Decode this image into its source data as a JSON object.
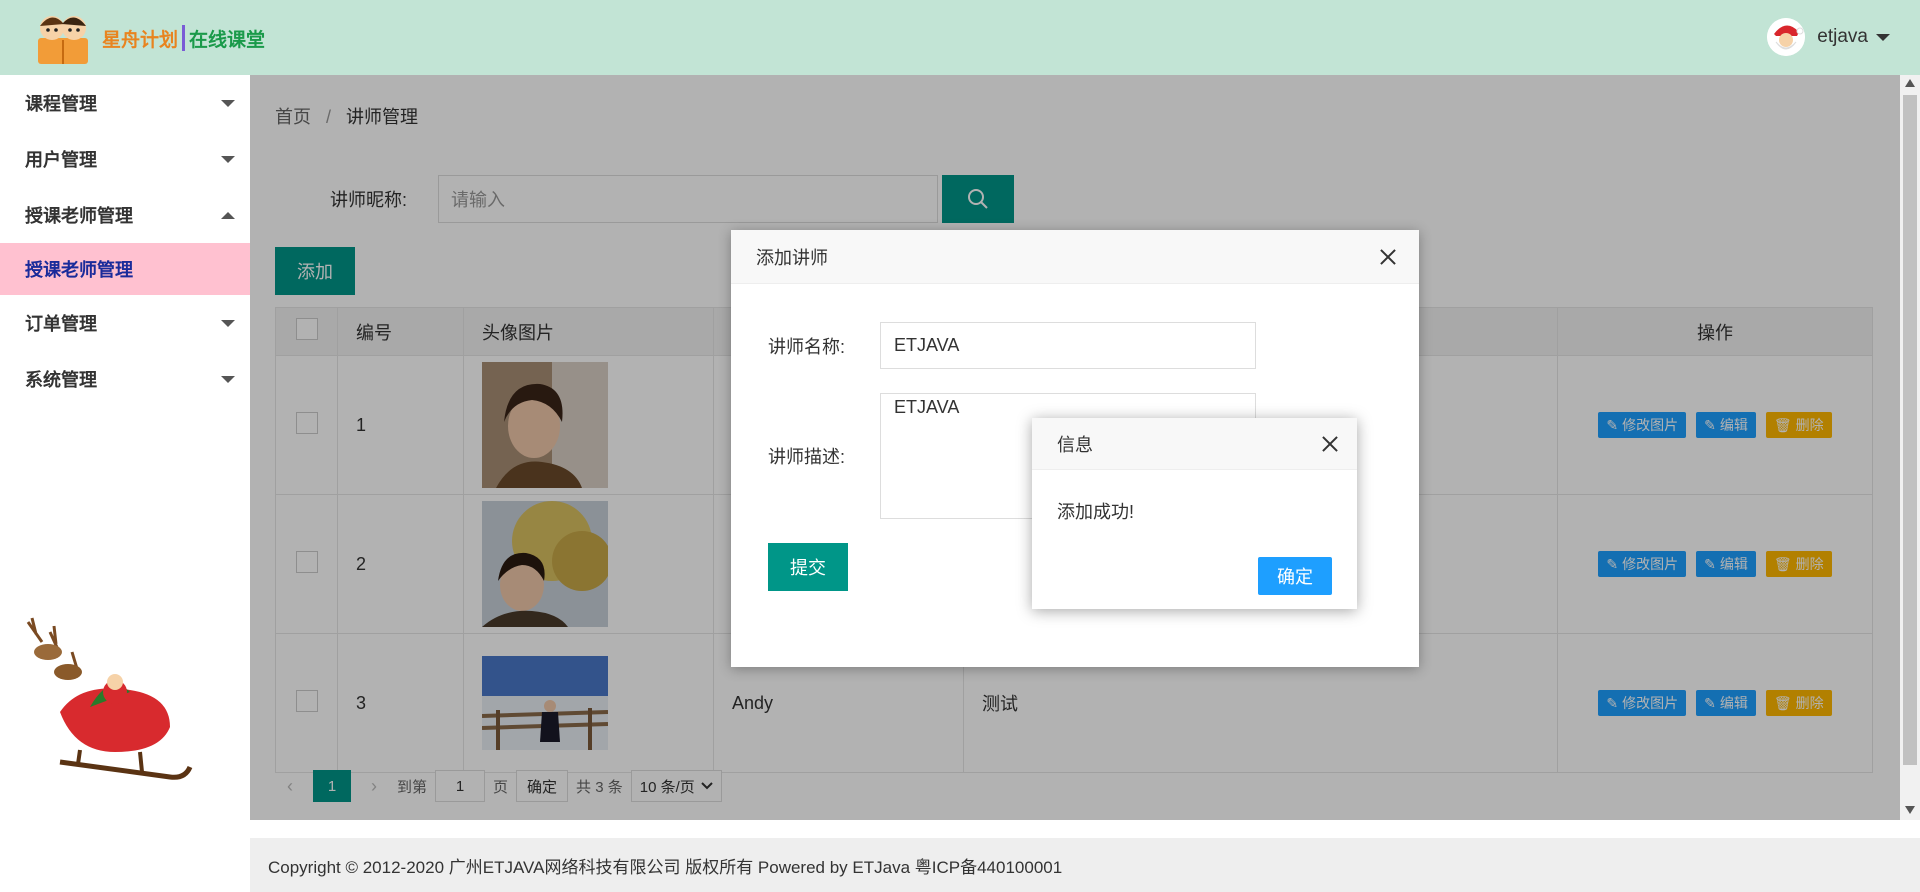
{
  "header": {
    "logo_text_a": "星舟计划",
    "logo_text_b": "在线课堂",
    "username": "etjava"
  },
  "sidebar": {
    "items": [
      {
        "label": "课程管理",
        "expanded": false
      },
      {
        "label": "用户管理",
        "expanded": false
      },
      {
        "label": "授课老师管理",
        "expanded": true
      },
      {
        "label": "授课老师管理",
        "sub": true,
        "active": true
      },
      {
        "label": "订单管理",
        "expanded": false
      },
      {
        "label": "系统管理",
        "expanded": false
      }
    ]
  },
  "breadcrumb": {
    "home": "首页",
    "sep": "/",
    "current": "讲师管理"
  },
  "search": {
    "label": "讲师昵称:",
    "placeholder": "请输入"
  },
  "toolbar": {
    "add_label": "添加"
  },
  "table": {
    "headers": [
      "编号",
      "头像图片",
      "",
      "",
      "操作"
    ],
    "rows": [
      {
        "id": "1",
        "name": "",
        "desc": ""
      },
      {
        "id": "2",
        "name": "",
        "desc": ""
      },
      {
        "id": "3",
        "name": "Andy",
        "desc": "测试"
      }
    ],
    "ops": {
      "edit_photo": "修改图片",
      "edit": "编辑",
      "delete": "删除"
    }
  },
  "pager": {
    "current": "1",
    "goto_label": "到第",
    "goto_value": "1",
    "page_label": "页",
    "confirm": "确定",
    "total": "共 3 条",
    "per_page": "10 条/页"
  },
  "footer": {
    "text": "Copyright © 2012-2020 广州ETJAVA网络科技有限公司 版权所有 Powered by ETJava 粤ICP备440100001"
  },
  "dialog": {
    "title": "添加讲师",
    "name_label": "讲师名称:",
    "name_value": "ETJAVA",
    "desc_label": "讲师描述:",
    "desc_value": "ETJAVA",
    "submit": "提交"
  },
  "message": {
    "title": "信息",
    "body": "添加成功!",
    "ok": "确定"
  },
  "colors": {
    "primary": "#009688",
    "blue": "#1e9fff",
    "orange": "#ffb800",
    "header_bg": "#c2e4d5",
    "active_menu": "#ffc1d0"
  }
}
